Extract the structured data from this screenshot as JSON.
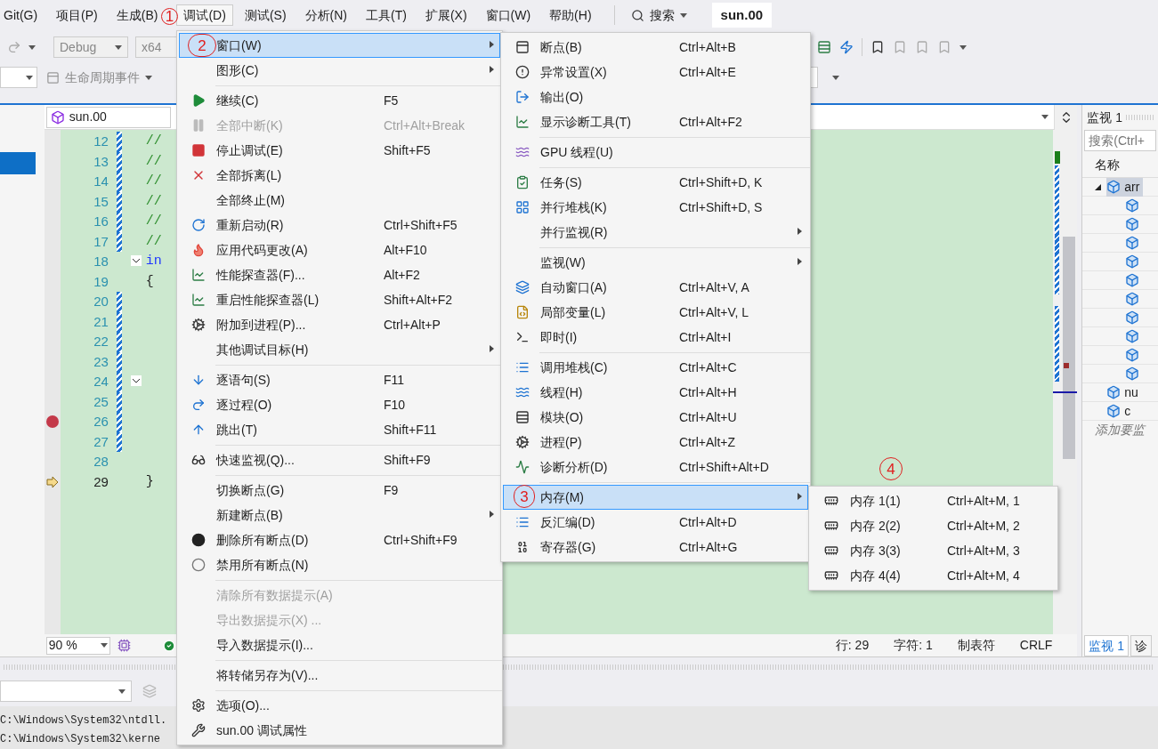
{
  "menu_bar": [
    {
      "label": "Git(G)",
      "selected": false
    },
    {
      "label": "项目(P)",
      "selected": false
    },
    {
      "label": "生成(B)",
      "selected": false
    },
    {
      "label": "调试(D)",
      "selected": true
    },
    {
      "label": "测试(S)",
      "selected": false
    },
    {
      "label": "分析(N)",
      "selected": false
    },
    {
      "label": "工具(T)",
      "selected": false
    },
    {
      "label": "扩展(X)",
      "selected": false
    },
    {
      "label": "窗口(W)",
      "selected": false
    },
    {
      "label": "帮助(H)",
      "selected": false
    }
  ],
  "search": {
    "label": "搜索"
  },
  "solution_title": "sun.00",
  "toolbar": {
    "configuration": "Debug",
    "platform": "x64",
    "lifecycle": "生命周期事件"
  },
  "editor": {
    "tab": "sun.00",
    "lines": [
      {
        "number": "12",
        "code": "//",
        "kind": "comment",
        "changed": true,
        "fold": false,
        "breakpoint": false,
        "current": false
      },
      {
        "number": "13",
        "code": "//",
        "kind": "comment",
        "changed": true,
        "fold": false,
        "breakpoint": false,
        "current": false
      },
      {
        "number": "14",
        "code": "//",
        "kind": "comment",
        "changed": true,
        "fold": false,
        "breakpoint": false,
        "current": false
      },
      {
        "number": "15",
        "code": "//",
        "kind": "comment",
        "changed": true,
        "fold": false,
        "breakpoint": false,
        "current": false
      },
      {
        "number": "16",
        "code": "//",
        "kind": "comment",
        "changed": true,
        "fold": false,
        "breakpoint": false,
        "current": false
      },
      {
        "number": "17",
        "code": "//",
        "kind": "comment",
        "changed": true,
        "fold": false,
        "breakpoint": false,
        "current": false
      },
      {
        "number": "18",
        "code": "in",
        "kind": "keyword",
        "changed": false,
        "fold": true,
        "breakpoint": false,
        "current": false
      },
      {
        "number": "19",
        "code": "{",
        "kind": "plain",
        "changed": false,
        "fold": false,
        "breakpoint": false,
        "current": false
      },
      {
        "number": "20",
        "changed": true,
        "fold": false,
        "breakpoint": false,
        "current": false
      },
      {
        "number": "21",
        "changed": true,
        "fold": false,
        "breakpoint": false,
        "current": false
      },
      {
        "number": "22",
        "changed": true,
        "fold": false,
        "breakpoint": false,
        "current": false
      },
      {
        "number": "23",
        "changed": true,
        "fold": false,
        "breakpoint": false,
        "current": false
      },
      {
        "number": "24",
        "changed": true,
        "fold": true,
        "breakpoint": false,
        "current": false
      },
      {
        "number": "25",
        "changed": true,
        "fold": false,
        "breakpoint": false,
        "current": false
      },
      {
        "number": "26",
        "changed": true,
        "fold": false,
        "breakpoint": true,
        "current": false
      },
      {
        "number": "27",
        "changed": true,
        "fold": false,
        "breakpoint": false,
        "current": false
      },
      {
        "number": "28",
        "changed": false,
        "fold": false,
        "breakpoint": false,
        "current": false
      },
      {
        "number": "29",
        "code": "}",
        "kind": "plain",
        "changed": false,
        "fold": false,
        "breakpoint": false,
        "current": true
      }
    ],
    "zoom": "90 %",
    "status": [
      "行: 29",
      "字符: 1",
      "制表符",
      "CRLF"
    ]
  },
  "watch_panel": {
    "title": "监视 1",
    "placeholder": "搜索(Ctrl+",
    "column": "名称",
    "items": [
      {
        "name": "arr",
        "expanded": true,
        "selected": true,
        "children": [
          {
            "kind": "variable"
          },
          {
            "kind": "variable"
          },
          {
            "kind": "variable"
          },
          {
            "kind": "variable"
          },
          {
            "kind": "variable"
          },
          {
            "kind": "variable"
          },
          {
            "kind": "variable"
          },
          {
            "kind": "variable"
          },
          {
            "kind": "variable"
          },
          {
            "kind": "variable"
          }
        ]
      },
      {
        "name": "nu",
        "selected": false
      },
      {
        "name": "c",
        "selected": false
      }
    ],
    "add_row": "添加要监",
    "tabs": [
      {
        "label": "监视 1",
        "selected": true
      },
      {
        "label": "诊",
        "selected": false
      }
    ]
  },
  "output": {
    "lines": [
      "C:\\Windows\\System32\\ntdll.",
      "C:\\Windows\\System32\\kerne"
    ]
  },
  "debug_menu": [
    {
      "kind": "item",
      "label": "窗口(W)",
      "submenu": true,
      "selected": true,
      "disabled": false
    },
    {
      "kind": "item",
      "label": "图形(C)",
      "submenu": true,
      "selected": false,
      "disabled": false
    },
    {
      "kind": "separator"
    },
    {
      "kind": "item",
      "label": "继续(C)",
      "shortcut": "F5",
      "submenu": false,
      "selected": false,
      "disabled": false
    },
    {
      "kind": "item",
      "label": "全部中断(K)",
      "shortcut": "Ctrl+Alt+Break",
      "submenu": false,
      "selected": false,
      "disabled": true
    },
    {
      "kind": "item",
      "label": "停止调试(E)",
      "shortcut": "Shift+F5",
      "submenu": false,
      "selected": false,
      "disabled": false
    },
    {
      "kind": "item",
      "label": "全部拆离(L)",
      "submenu": false,
      "selected": false,
      "disabled": false
    },
    {
      "kind": "item",
      "label": "全部终止(M)",
      "submenu": false,
      "selected": false,
      "disabled": false
    },
    {
      "kind": "item",
      "label": "重新启动(R)",
      "shortcut": "Ctrl+Shift+F5",
      "submenu": false,
      "selected": false,
      "disabled": false
    },
    {
      "kind": "item",
      "label": "应用代码更改(A)",
      "shortcut": "Alt+F10",
      "submenu": false,
      "selected": false,
      "disabled": false
    },
    {
      "kind": "item",
      "label": "性能探查器(F)...",
      "shortcut": "Alt+F2",
      "submenu": false,
      "selected": false,
      "disabled": false
    },
    {
      "kind": "item",
      "label": "重启性能探查器(L)",
      "shortcut": "Shift+Alt+F2",
      "submenu": false,
      "selected": false,
      "disabled": false
    },
    {
      "kind": "item",
      "label": "附加到进程(P)...",
      "shortcut": "Ctrl+Alt+P",
      "submenu": false,
      "selected": false,
      "disabled": false
    },
    {
      "kind": "item",
      "label": "其他调试目标(H)",
      "submenu": true,
      "selected": false,
      "disabled": false
    },
    {
      "kind": "separator"
    },
    {
      "kind": "item",
      "label": "逐语句(S)",
      "shortcut": "F11",
      "submenu": false,
      "selected": false,
      "disabled": false
    },
    {
      "kind": "item",
      "label": "逐过程(O)",
      "shortcut": "F10",
      "submenu": false,
      "selected": false,
      "disabled": false
    },
    {
      "kind": "item",
      "label": "跳出(T)",
      "shortcut": "Shift+F11",
      "submenu": false,
      "selected": false,
      "disabled": false
    },
    {
      "kind": "separator"
    },
    {
      "kind": "item",
      "label": "快速监视(Q)...",
      "shortcut": "Shift+F9",
      "submenu": false,
      "selected": false,
      "disabled": false
    },
    {
      "kind": "separator"
    },
    {
      "kind": "item",
      "label": "切换断点(G)",
      "shortcut": "F9",
      "submenu": false,
      "selected": false,
      "disabled": false
    },
    {
      "kind": "item",
      "label": "新建断点(B)",
      "submenu": true,
      "selected": false,
      "disabled": false
    },
    {
      "kind": "item",
      "label": "删除所有断点(D)",
      "shortcut": "Ctrl+Shift+F9",
      "submenu": false,
      "selected": false,
      "disabled": false
    },
    {
      "kind": "item",
      "label": "禁用所有断点(N)",
      "submenu": false,
      "selected": false,
      "disabled": false
    },
    {
      "kind": "separator"
    },
    {
      "kind": "item",
      "label": "清除所有数据提示(A)",
      "submenu": false,
      "selected": false,
      "disabled": true
    },
    {
      "kind": "item",
      "label": "导出数据提示(X) ...",
      "submenu": false,
      "selected": false,
      "disabled": true
    },
    {
      "kind": "item",
      "label": "导入数据提示(I)...",
      "submenu": false,
      "selected": false,
      "disabled": false
    },
    {
      "kind": "separator"
    },
    {
      "kind": "item",
      "label": "将转储另存为(V)...",
      "submenu": false,
      "selected": false,
      "disabled": false
    },
    {
      "kind": "separator"
    },
    {
      "kind": "item",
      "label": "选项(O)...",
      "submenu": false,
      "selected": false,
      "disabled": false
    },
    {
      "kind": "item",
      "label": "sun.00 调试属性",
      "submenu": false,
      "selected": false,
      "disabled": false
    }
  ],
  "window_menu": [
    {
      "kind": "item",
      "label": "断点(B)",
      "shortcut": "Ctrl+Alt+B",
      "submenu": false,
      "selected": false
    },
    {
      "kind": "item",
      "label": "异常设置(X)",
      "shortcut": "Ctrl+Alt+E",
      "submenu": false,
      "selected": false
    },
    {
      "kind": "item",
      "label": "输出(O)",
      "submenu": false,
      "selected": false
    },
    {
      "kind": "item",
      "label": "显示诊断工具(T)",
      "shortcut": "Ctrl+Alt+F2",
      "submenu": false,
      "selected": false
    },
    {
      "kind": "separator"
    },
    {
      "kind": "item",
      "label": "GPU 线程(U)",
      "submenu": false,
      "selected": false
    },
    {
      "kind": "separator"
    },
    {
      "kind": "item",
      "label": "任务(S)",
      "shortcut": "Ctrl+Shift+D, K",
      "submenu": false,
      "selected": false
    },
    {
      "kind": "item",
      "label": "并行堆栈(K)",
      "shortcut": "Ctrl+Shift+D, S",
      "submenu": false,
      "selected": false
    },
    {
      "kind": "item",
      "label": "并行监视(R)",
      "submenu": true,
      "selected": false
    },
    {
      "kind": "separator"
    },
    {
      "kind": "item",
      "label": "监视(W)",
      "submenu": true,
      "selected": false
    },
    {
      "kind": "item",
      "label": "自动窗口(A)",
      "shortcut": "Ctrl+Alt+V, A",
      "submenu": false,
      "selected": false
    },
    {
      "kind": "item",
      "label": "局部变量(L)",
      "shortcut": "Ctrl+Alt+V, L",
      "submenu": false,
      "selected": false
    },
    {
      "kind": "item",
      "label": "即时(I)",
      "shortcut": "Ctrl+Alt+I",
      "submenu": false,
      "selected": false
    },
    {
      "kind": "separator"
    },
    {
      "kind": "item",
      "label": "调用堆栈(C)",
      "shortcut": "Ctrl+Alt+C",
      "submenu": false,
      "selected": false
    },
    {
      "kind": "item",
      "label": "线程(H)",
      "shortcut": "Ctrl+Alt+H",
      "submenu": false,
      "selected": false
    },
    {
      "kind": "item",
      "label": "模块(O)",
      "shortcut": "Ctrl+Alt+U",
      "submenu": false,
      "selected": false
    },
    {
      "kind": "item",
      "label": "进程(P)",
      "shortcut": "Ctrl+Alt+Z",
      "submenu": false,
      "selected": false
    },
    {
      "kind": "item",
      "label": "诊断分析(D)",
      "shortcut": "Ctrl+Shift+Alt+D",
      "submenu": false,
      "selected": false
    },
    {
      "kind": "separator"
    },
    {
      "kind": "item",
      "label": "内存(M)",
      "submenu": true,
      "selected": true
    },
    {
      "kind": "item",
      "label": "反汇编(D)",
      "shortcut": "Ctrl+Alt+D",
      "submenu": false,
      "selected": false
    },
    {
      "kind": "item",
      "label": "寄存器(G)",
      "shortcut": "Ctrl+Alt+G",
      "submenu": false,
      "selected": false
    }
  ],
  "memory_menu": [
    {
      "kind": "item",
      "label": "内存 1(1)",
      "shortcut": "Ctrl+Alt+M, 1",
      "submenu": false,
      "selected": false
    },
    {
      "kind": "item",
      "label": "内存 2(2)",
      "shortcut": "Ctrl+Alt+M, 2",
      "submenu": false,
      "selected": false
    },
    {
      "kind": "item",
      "label": "内存 3(3)",
      "shortcut": "Ctrl+Alt+M, 3",
      "submenu": false,
      "selected": false
    },
    {
      "kind": "item",
      "label": "内存 4(4)",
      "shortcut": "Ctrl+Alt+M, 4",
      "submenu": false,
      "selected": false
    }
  ],
  "annotations": [
    "1",
    "2",
    "3",
    "4"
  ]
}
